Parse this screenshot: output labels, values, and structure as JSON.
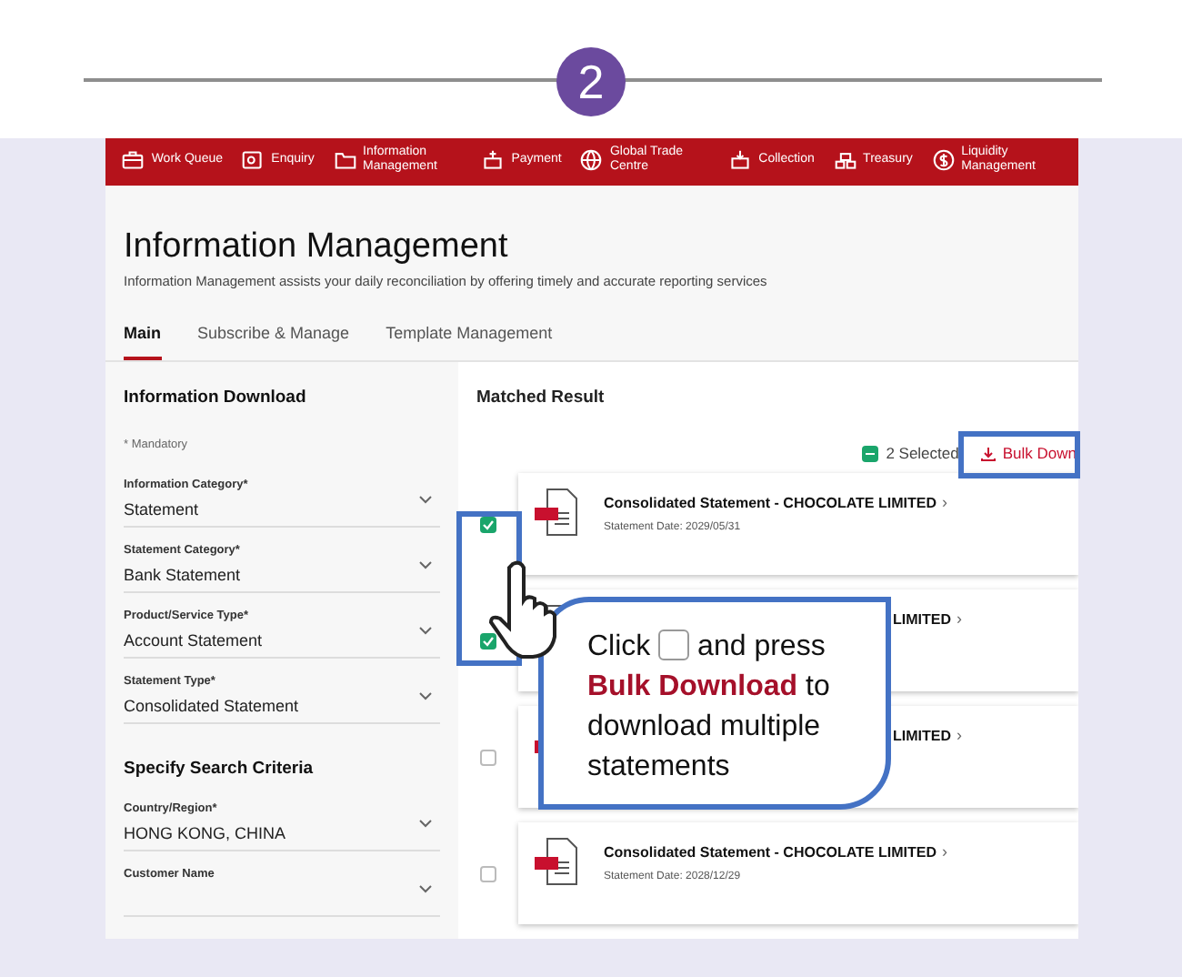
{
  "step": {
    "number": "2"
  },
  "nav": [
    {
      "label": "Work Queue"
    },
    {
      "label": "Enquiry"
    },
    {
      "label": "Information Management"
    },
    {
      "label": "Payment"
    },
    {
      "label": "Global Trade Centre"
    },
    {
      "label": "Collection"
    },
    {
      "label": "Treasury"
    },
    {
      "label": "Liquidity Management"
    }
  ],
  "page": {
    "title": "Information Management",
    "subtitle": "Information Management assists your daily reconciliation by offering timely and accurate reporting services"
  },
  "tabs": [
    {
      "label": "Main",
      "selected": true
    },
    {
      "label": "Subscribe & Manage",
      "selected": false
    },
    {
      "label": "Template Management",
      "selected": false
    }
  ],
  "sidebar": {
    "heading": "Information Download",
    "note": "* Mandatory",
    "fields": [
      {
        "label": "Information Category*",
        "value": "Statement"
      },
      {
        "label": "Statement Category*",
        "value": "Bank Statement"
      },
      {
        "label": "Product/Service Type*",
        "value": "Account Statement"
      },
      {
        "label": "Statement Type*",
        "value": "Consolidated Statement"
      }
    ],
    "criteria_heading": "Specify Search Criteria",
    "criteria_fields": [
      {
        "label": "Country/Region*",
        "value": "HONG KONG, CHINA"
      },
      {
        "label": "Customer Name"
      }
    ]
  },
  "results": {
    "heading": "Matched Result",
    "select_all_partial": true,
    "selected_count": "2 Selected",
    "bulk_button": "Bulk Down",
    "items": [
      {
        "kind": "full",
        "checked": true,
        "title": "Consolidated Statement - CHOCOLATE LIMITED",
        "chevron": "›",
        "date": "Statement Date:  2029/05/31"
      },
      {
        "kind": "covered",
        "checked": true,
        "title": "LIMITED",
        "chevron": "›"
      },
      {
        "kind": "covered",
        "checked": false,
        "title": "LIMITED",
        "chevron": "›"
      },
      {
        "kind": "full",
        "checked": false,
        "title": "Consolidated Statement - CHOCOLATE LIMITED",
        "chevron": "›",
        "date": "Statement Date:  2028/12/29"
      }
    ]
  },
  "callout": {
    "before": "Click",
    "after": "and press",
    "highlight": "Bulk Download",
    "rest": "to download multiple statements"
  }
}
